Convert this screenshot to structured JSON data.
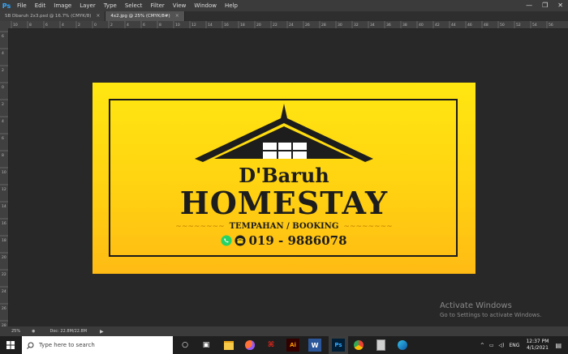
{
  "menu": [
    "File",
    "Edit",
    "Image",
    "Layer",
    "Type",
    "Select",
    "Filter",
    "View",
    "Window",
    "Help"
  ],
  "app_logo": "Ps",
  "tabs": [
    {
      "label": "SB Dbaruh 2x3.psd @ 16.7% (CMYK/8)",
      "close": "×"
    },
    {
      "label": "4x2.jpg @ 25% (CMYK/8#)",
      "close": "×"
    }
  ],
  "ruler_top": [
    "10",
    "8",
    "6",
    "4",
    "2",
    "0",
    "2",
    "4",
    "6",
    "8",
    "10",
    "12",
    "14",
    "16",
    "18",
    "20",
    "22",
    "24",
    "26",
    "28",
    "30",
    "32",
    "34",
    "36",
    "38",
    "40",
    "42",
    "44",
    "46",
    "48",
    "50",
    "52",
    "54",
    "56"
  ],
  "ruler_left": [
    "6",
    "4",
    "2",
    "0",
    "2",
    "4",
    "6",
    "8",
    "10",
    "12",
    "14",
    "16",
    "18",
    "20",
    "22",
    "24",
    "26",
    "28"
  ],
  "design": {
    "brand": "D'Baruh",
    "title": "HOMESTAY",
    "subtitle": "TEMPAHAN / BOOKING",
    "phone": "019 - 9886078",
    "colors": {
      "top": "#ffe711",
      "bottom": "#ffbb14",
      "ink": "#1d1d1d"
    }
  },
  "status": {
    "zoom": "25%",
    "doc": "Doc: 22.8M/22.8M"
  },
  "watermark": {
    "title": "Activate Windows",
    "subtitle": "Go to Settings to activate Windows."
  },
  "taskbar": {
    "search_placeholder": "Type here to search",
    "time": "12:37 PM",
    "date": "4/1/2021",
    "lang": "ENG",
    "apps": [
      "cortana-icon",
      "task-view-icon",
      "file-explorer-icon",
      "firefox-icon",
      "acrobat-icon",
      "illustrator-icon",
      "word-icon",
      "photoshop-icon",
      "chrome-icon",
      "calculator-icon",
      "edge-icon"
    ]
  }
}
